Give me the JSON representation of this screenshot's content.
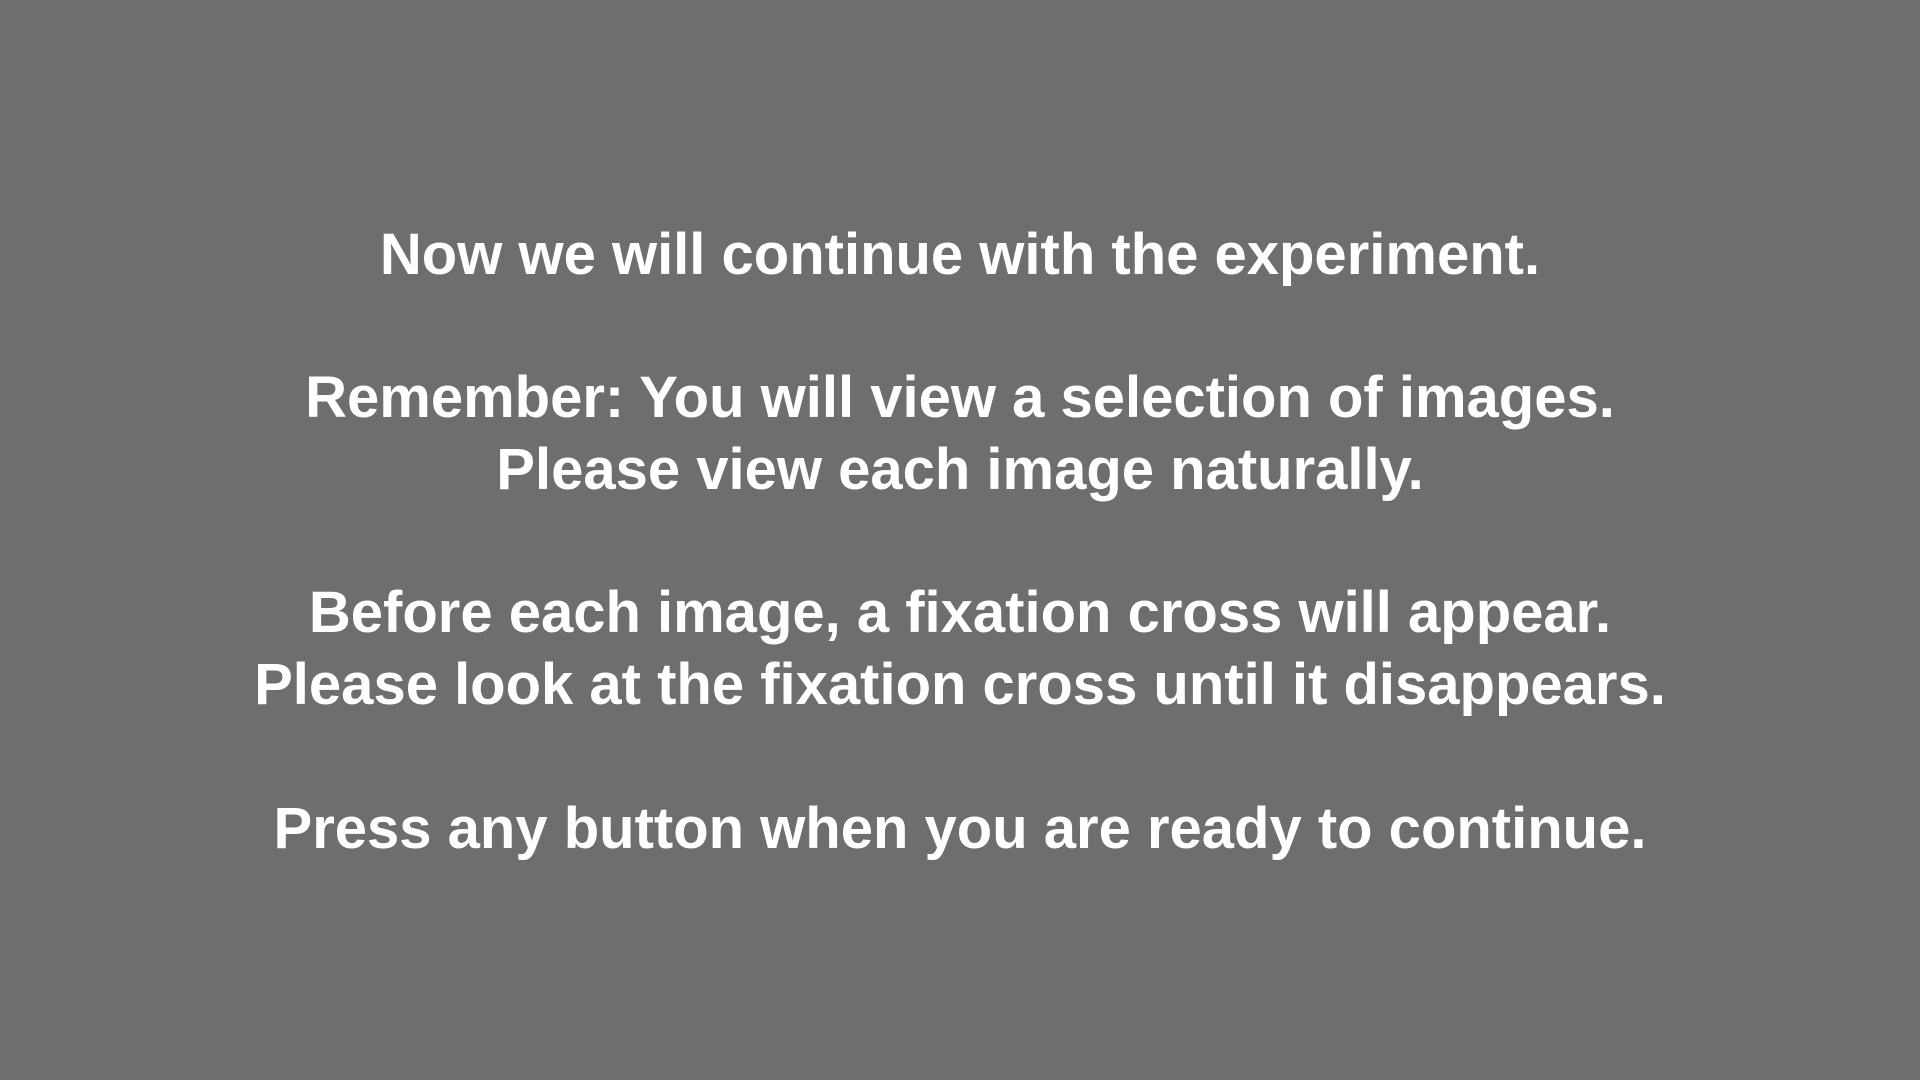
{
  "background_color": "#6e6e6e",
  "text_color": "#ffffff",
  "instructions": {
    "intro": "Now we will continue with the experiment.",
    "reminder_line1": "Remember: You will view a selection of images.",
    "reminder_line2": "Please view each image naturally.",
    "fixation_line1": "Before each image, a fixation cross will appear.",
    "fixation_line2": "Please look at the fixation cross until it disappears.",
    "prompt": "Press any button when you are ready to continue."
  }
}
